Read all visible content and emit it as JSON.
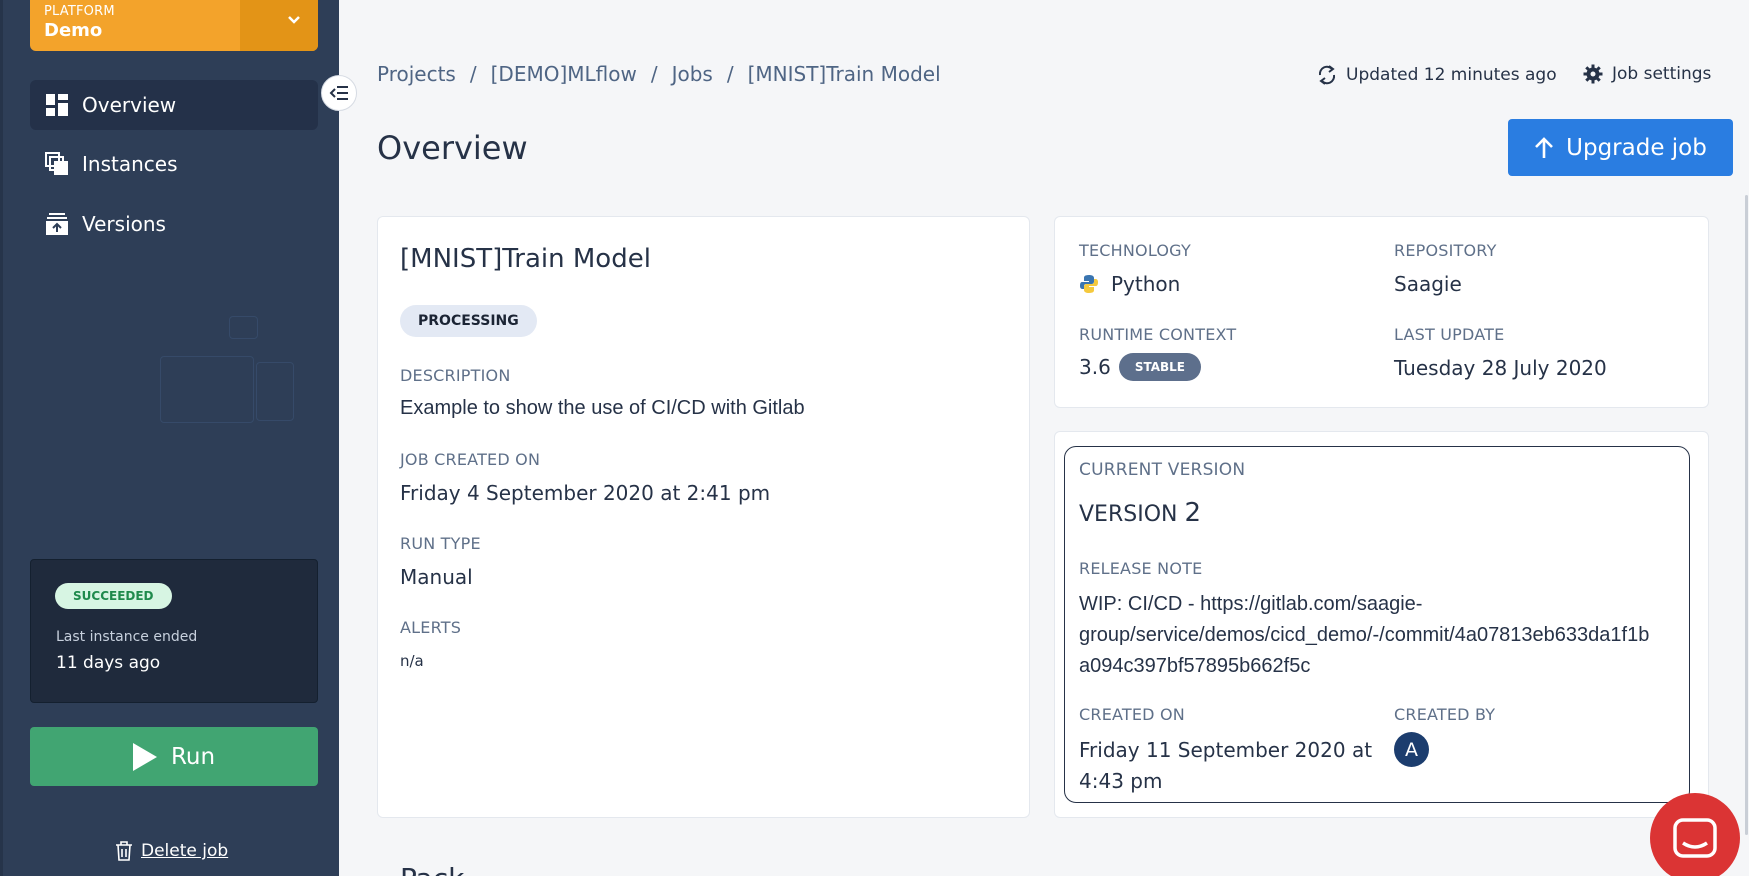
{
  "platform": {
    "label": "PLATFORM",
    "name": "Demo"
  },
  "sidebar": {
    "items": [
      {
        "label": "Overview",
        "icon": "dashboard-icon",
        "active": true
      },
      {
        "label": "Instances",
        "icon": "instances-icon",
        "active": false
      },
      {
        "label": "Versions",
        "icon": "versions-icon",
        "active": false
      }
    ],
    "last_instance": {
      "status": "SUCCEEDED",
      "label": "Last instance ended",
      "time": "11 days ago"
    },
    "run_label": "Run",
    "delete_label": "Delete job"
  },
  "header": {
    "breadcrumb": [
      "Projects",
      "[DEMO]MLflow",
      "Jobs",
      "[MNIST]Train Model"
    ],
    "updated": "Updated 12 minutes ago",
    "job_settings": "Job settings",
    "title": "Overview",
    "upgrade_label": "Upgrade job"
  },
  "job": {
    "name": "[MNIST]Train Model",
    "status": "PROCESSING",
    "description_label": "DESCRIPTION",
    "description": "Example to show the use of CI/CD with Gitlab",
    "created_label": "JOB CREATED ON",
    "created": "Friday 4 September 2020 at 2:41 pm",
    "run_type_label": "RUN TYPE",
    "run_type": "Manual",
    "alerts_label": "ALERTS",
    "alerts": "n/a"
  },
  "tech": {
    "technology_label": "TECHNOLOGY",
    "technology": "Python",
    "repository_label": "REPOSITORY",
    "repository": "Saagie",
    "runtime_label": "RUNTIME CONTEXT",
    "runtime": "3.6",
    "runtime_badge": "STABLE",
    "last_update_label": "LAST UPDATE",
    "last_update": "Tuesday 28 July 2020"
  },
  "version": {
    "current_label": "CURRENT VERSION",
    "version_word": "VERSION",
    "version_num": "2",
    "release_label": "RELEASE NOTE",
    "release_line1": "WIP: CI/CD - https://gitlab.com/saagie-",
    "release_line2": "group/service/demos/cicd_demo/-/commit/4a07813eb633da1f1b",
    "release_line3": "a094c397bf57895b662f5c",
    "created_label": "CREATED ON",
    "created_line1": "Friday 11 September 2020 at",
    "created_line2": "4:43 pm",
    "created_by_label": "CREATED BY",
    "created_by_initial": "A"
  },
  "bottom_partial": "Pack",
  "colors": {
    "sidebar": "#2e3e57",
    "platform": "#f3a32b",
    "run": "#41a572",
    "upgrade": "#2a7de1",
    "chat": "#db3434"
  }
}
